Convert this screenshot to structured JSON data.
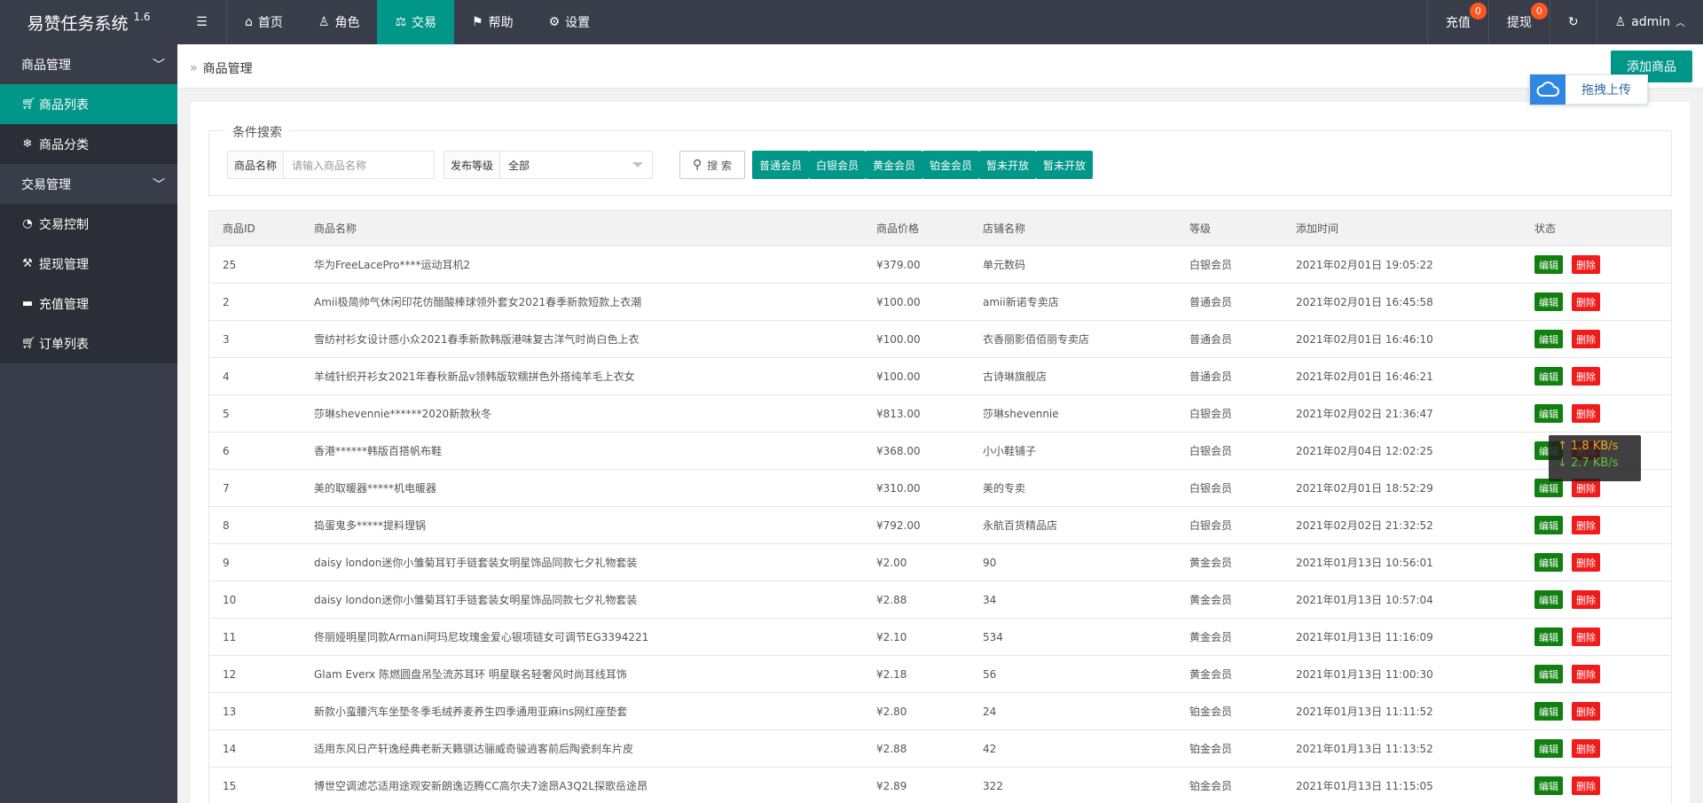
{
  "app": {
    "title": "易赞任务系统",
    "version": "1.6"
  },
  "nav": {
    "toggle_icon": "menu-icon",
    "items": [
      {
        "label": "首页",
        "icon": "home-icon"
      },
      {
        "label": "角色",
        "icon": "user-icon"
      },
      {
        "label": "交易",
        "icon": "scale-icon",
        "active": true
      },
      {
        "label": "帮助",
        "icon": "flag-icon"
      },
      {
        "label": "设置",
        "icon": "gear-icon"
      }
    ],
    "right": {
      "recharge": "充值",
      "recharge_badge": "0",
      "withdraw": "提现",
      "withdraw_badge": "0",
      "user": "admin"
    }
  },
  "sidebar": {
    "groups": [
      {
        "label": "商品管理",
        "items": [
          {
            "label": "商品列表",
            "icon": "cart-icon",
            "active": true
          },
          {
            "label": "商品分类",
            "icon": "snowflake-icon"
          }
        ]
      },
      {
        "label": "交易管理",
        "items": [
          {
            "label": "交易控制",
            "icon": "dashboard-icon"
          },
          {
            "label": "提现管理",
            "icon": "gavel-icon"
          },
          {
            "label": "充值管理",
            "icon": "chat-icon"
          },
          {
            "label": "订单列表",
            "icon": "cart-icon"
          }
        ]
      }
    ]
  },
  "page": {
    "breadcrumb": "商品管理",
    "add_button": "添加商品",
    "upload_label": "拖拽上传"
  },
  "search": {
    "legend": "条件搜索",
    "name_label": "商品名称",
    "name_placeholder": "请输入商品名称",
    "level_label": "发布等级",
    "level_value": "全部",
    "search_button": "搜 索",
    "levels": [
      "普通会员",
      "白银会员",
      "黄金会员",
      "铂金会员",
      "暂未开放",
      "暂未开放"
    ]
  },
  "table": {
    "headers": [
      "商品ID",
      "商品名称",
      "商品价格",
      "店铺名称",
      "等级",
      "添加时间",
      "状态"
    ],
    "edit_label": "编辑",
    "delete_label": "删除",
    "rows": [
      [
        "25",
        "华为FreeLacePro****运动耳机2",
        "¥379.00",
        "单元数码",
        "白银会员",
        "2021年02月01日 19:05:22"
      ],
      [
        "2",
        "Amii极简帅气休闲印花仿醋酸棒球领外套女2021春季新款短款上衣潮",
        "¥100.00",
        "amii新诺专卖店",
        "普通会员",
        "2021年02月01日 16:45:58"
      ],
      [
        "3",
        "雪纺衬衫女设计感小众2021春季新款韩版港味复古洋气时尚白色上衣",
        "¥100.00",
        "衣香丽影佰佰丽专卖店",
        "普通会员",
        "2021年02月01日 16:46:10"
      ],
      [
        "4",
        "羊绒针织开衫女2021年春秋新品v领韩版软糯拼色外搭纯羊毛上衣女",
        "¥100.00",
        "古诗琳旗舰店",
        "普通会员",
        "2021年02月01日 16:46:21"
      ],
      [
        "5",
        "莎琳shevennie******2020新款秋冬",
        "¥813.00",
        "莎琳shevennie",
        "白银会员",
        "2021年02月02日 21:36:47"
      ],
      [
        "6",
        "香港******韩版百搭帆布鞋",
        "¥368.00",
        "小小鞋铺子",
        "白银会员",
        "2021年02月04日 12:02:25"
      ],
      [
        "7",
        "美的取暖器*****机电暖器",
        "¥310.00",
        "美的专卖",
        "白银会员",
        "2021年02月01日 18:52:29"
      ],
      [
        "8",
        "捣蛋鬼多*****提料理锅",
        "¥792.00",
        "永航百货精品店",
        "白银会员",
        "2021年02月02日 21:32:52"
      ],
      [
        "9",
        "daisy london迷你小雏菊耳钉手链套装女明星饰品同款七夕礼物套装",
        "¥2.00",
        "90",
        "黄金会员",
        "2021年01月13日 10:56:01"
      ],
      [
        "10",
        "daisy london迷你小雏菊耳钉手链套装女明星饰品同款七夕礼物套装",
        "¥2.88",
        "34",
        "黄金会员",
        "2021年01月13日 10:57:04"
      ],
      [
        "11",
        "佟丽娅明星同款Armani阿玛尼玫瑰金爱心银项链女可调节EG3394221",
        "¥2.10",
        "534",
        "黄金会员",
        "2021年01月13日 11:16:09"
      ],
      [
        "12",
        "Glam Everx 陈燃圆盘吊坠流苏耳环 明星联名轻奢风时尚耳线耳饰",
        "¥2.18",
        "56",
        "黄金会员",
        "2021年01月13日 11:00:30"
      ],
      [
        "13",
        "新款小蛮腰汽车坐垫冬季毛绒养麦养生四季通用亚麻ins网红座垫套",
        "¥2.80",
        "24",
        "铂金会员",
        "2021年01月13日 11:11:52"
      ],
      [
        "14",
        "适用东风日产轩逸经典老新天籁骐达骊威奇骏逍客前后陶瓷刹车片皮",
        "¥2.88",
        "42",
        "铂金会员",
        "2021年01月13日 11:13:52"
      ],
      [
        "15",
        "博世空调滤芯适用途观安新朗逸迈腾CC高尔夫7途昂A3Q2L探歌岳途昂",
        "¥2.89",
        "322",
        "铂金会员",
        "2021年01月13日 11:15:05"
      ]
    ]
  },
  "speed": {
    "up": "1.8 KB/s",
    "down": "2.7 KB/s"
  },
  "colors": {
    "header": "#393d49",
    "accent": "#009688",
    "edit": "#118011",
    "delete": "#f01b1b",
    "badge": "#ff5722"
  }
}
